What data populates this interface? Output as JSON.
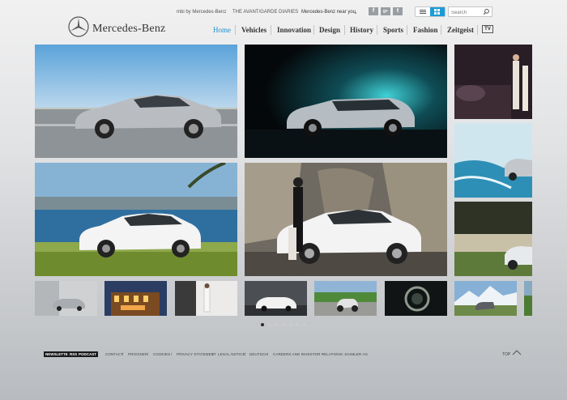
{
  "header": {
    "brand": "Mercedes-Benz",
    "top_links": [
      "mbi by Mercedes-Benz",
      "THE AVANT/GARDE DIARIES"
    ],
    "near_you": "Mercedes-Benz near you",
    "social": [
      "f",
      "g+",
      "t"
    ],
    "search_placeholder": "Search"
  },
  "nav": {
    "items": [
      "Home",
      "Vehicles",
      "Innovation",
      "Design",
      "History",
      "Sports",
      "Fashion",
      "Zeitgeist"
    ],
    "tv": "TV",
    "active": "Home"
  },
  "carousel": {
    "pages": 7,
    "active_page": 1
  },
  "footer": {
    "badges": [
      "NEWSLETTER",
      "RSS",
      "PODCAST"
    ],
    "links": [
      "CONTACT",
      "PROVIDER",
      "COOKIES",
      "PRIVACY STATEMENT",
      "LEGAL NOTICE",
      "DEUTSCH",
      "CAREERS AND INVESTOR RELATIONS: DAIMLER AG"
    ],
    "top": "TOP"
  },
  "colors": {
    "accent": "#1d8fcb",
    "background": "#e2e3e5"
  }
}
